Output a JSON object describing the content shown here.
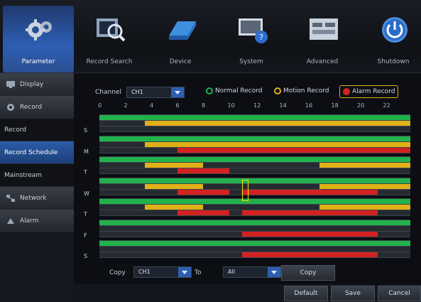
{
  "top_nav": [
    {
      "label": "Parameter",
      "icon": "gears-icon",
      "active": true
    },
    {
      "label": "Record Search",
      "icon": "record-search-icon",
      "active": false
    },
    {
      "label": "Device",
      "icon": "hard-drive-icon",
      "active": false
    },
    {
      "label": "System",
      "icon": "system-info-icon",
      "active": false
    },
    {
      "label": "Advanced",
      "icon": "advanced-settings-icon",
      "active": false
    },
    {
      "label": "Shutdown",
      "icon": "power-icon",
      "active": false
    }
  ],
  "sidebar": {
    "items": [
      {
        "label": "Display",
        "type": "hdr",
        "icon": "display-icon"
      },
      {
        "label": "Record",
        "type": "hdr",
        "icon": "record-gear-icon"
      },
      {
        "label": "Record",
        "type": "sub"
      },
      {
        "label": "Record Schedule",
        "type": "sel"
      },
      {
        "label": "Mainstream",
        "type": "sub"
      },
      {
        "label": "Network",
        "type": "hdr",
        "icon": "network-icon"
      },
      {
        "label": "Alarm",
        "type": "hdr",
        "icon": "alarm-icon"
      }
    ]
  },
  "channel": {
    "label": "Channel",
    "value": "CH1"
  },
  "legend": [
    {
      "label": "Normal Record",
      "color": "#22b24c"
    },
    {
      "label": "Motion Record",
      "color": "#e0b017"
    },
    {
      "label": "Alarm Record",
      "color": "#d32222"
    }
  ],
  "hours": [
    "0",
    "2",
    "4",
    "6",
    "8",
    "10",
    "12",
    "14",
    "16",
    "18",
    "20",
    "22"
  ],
  "days": [
    "S",
    "M",
    "T",
    "W",
    "T",
    "F",
    "S"
  ],
  "schedule": [
    {
      "normal": [
        0,
        24
      ],
      "motion": [
        3.5,
        24
      ],
      "alarm": []
    },
    {
      "normal": [
        0,
        24
      ],
      "motion": [
        3.5,
        24
      ],
      "alarm": [
        [
          6,
          24
        ]
      ]
    },
    {
      "normal": [
        0,
        24
      ],
      "motion": [
        [
          3.5,
          8
        ],
        [
          17,
          24
        ]
      ],
      "alarm": [
        [
          6,
          10
        ]
      ]
    },
    {
      "normal": [
        0,
        24
      ],
      "motion": [
        [
          3.5,
          8
        ],
        [
          17,
          24
        ]
      ],
      "alarm": [
        [
          6,
          10
        ],
        [
          11,
          21.5
        ]
      ]
    },
    {
      "normal": [
        0,
        24
      ],
      "motion": [
        [
          3.5,
          8
        ],
        [
          17,
          24
        ]
      ],
      "alarm": [
        [
          6,
          10
        ],
        [
          11,
          21.5
        ]
      ]
    },
    {
      "normal": [
        0,
        24
      ],
      "motion": [],
      "alarm": [
        [
          11,
          21.5
        ]
      ]
    },
    {
      "normal": [
        0,
        24
      ],
      "motion": [],
      "alarm": [
        [
          11,
          21.5
        ]
      ]
    }
  ],
  "copy": {
    "label": "Copy",
    "from": "CH1",
    "to_label": "To",
    "to": "All",
    "button": "Copy"
  },
  "buttons": {
    "default": "Default",
    "save": "Save",
    "cancel": "Cancel"
  }
}
